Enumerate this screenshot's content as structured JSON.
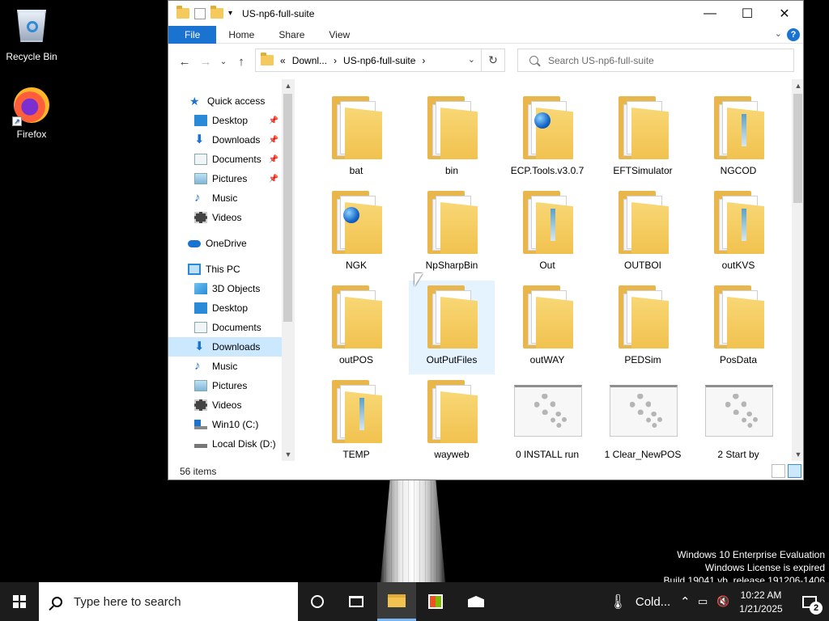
{
  "desktop": {
    "icons": [
      {
        "label": "Recycle Bin",
        "icon": "recycle-bin-icon"
      },
      {
        "label": "Firefox",
        "icon": "firefox-icon"
      }
    ],
    "watermark": {
      "line1": "Windows 10 Enterprise Evaluation",
      "line2": "Windows License is expired",
      "line3": "Build 19041.vb_release.191206-1406"
    }
  },
  "window": {
    "title": "US-np6-full-suite",
    "controls": {
      "minimize": "—",
      "maximize": "☐",
      "close": "✕"
    },
    "ribbon": {
      "file": "File",
      "home": "Home",
      "share": "Share",
      "view": "View",
      "help": "?",
      "expand": "⌄"
    },
    "address": {
      "overflow": "«",
      "crumb1": "Downl...",
      "sep1": "›",
      "crumb2": "US-np6-full-suite",
      "sep2": "›"
    },
    "search_placeholder": "Search US-np6-full-suite",
    "nav": {
      "quick_access": "Quick access",
      "qa_items": [
        "Desktop",
        "Downloads",
        "Documents",
        "Pictures",
        "Music",
        "Videos"
      ],
      "onedrive": "OneDrive",
      "this_pc": "This PC",
      "pc_items": [
        "3D Objects",
        "Desktop",
        "Documents",
        "Downloads",
        "Music",
        "Pictures",
        "Videos",
        "Win10 (C:)",
        "Local Disk (D:)"
      ],
      "selected": "Downloads"
    },
    "items": [
      {
        "name": "bat",
        "kind": "gear-folder"
      },
      {
        "name": "bin",
        "kind": "gear-folder"
      },
      {
        "name": "ECP.Tools.v3.0.7",
        "kind": "globe-folder"
      },
      {
        "name": "EFTSimulator",
        "kind": "folder"
      },
      {
        "name": "NGCOD",
        "kind": "strip-folder"
      },
      {
        "name": "NGK",
        "kind": "globe-folder"
      },
      {
        "name": "NpSharpBin",
        "kind": "gear-folder"
      },
      {
        "name": "Out",
        "kind": "strip-folder"
      },
      {
        "name": "OUTBOI",
        "kind": "folder"
      },
      {
        "name": "outKVS",
        "kind": "strip-folder"
      },
      {
        "name": "outPOS",
        "kind": "folder"
      },
      {
        "name": "OutPutFiles",
        "kind": "folder"
      },
      {
        "name": "outWAY",
        "kind": "folder"
      },
      {
        "name": "PEDSim",
        "kind": "gear-folder"
      },
      {
        "name": "PosData",
        "kind": "folder"
      },
      {
        "name": "TEMP",
        "kind": "strip-folder"
      },
      {
        "name": "wayweb",
        "kind": "folder"
      },
      {
        "name": "0 INSTALL run",
        "kind": "gear-file"
      },
      {
        "name": "1 Clear_NewPOS",
        "kind": "gear-file"
      },
      {
        "name": "2 Start by",
        "kind": "gear-file"
      }
    ],
    "status": "56 items"
  },
  "taskbar": {
    "search_placeholder": "Type here to search",
    "weather": "Cold...",
    "time": "10:22 AM",
    "date": "1/21/2025",
    "notifications": "2"
  },
  "colors": {
    "accent": "#1a73d1",
    "selection": "#cce8ff",
    "hover": "#e5f3ff",
    "taskbar": "#1c1c1c",
    "folder": "#f1c24f"
  }
}
